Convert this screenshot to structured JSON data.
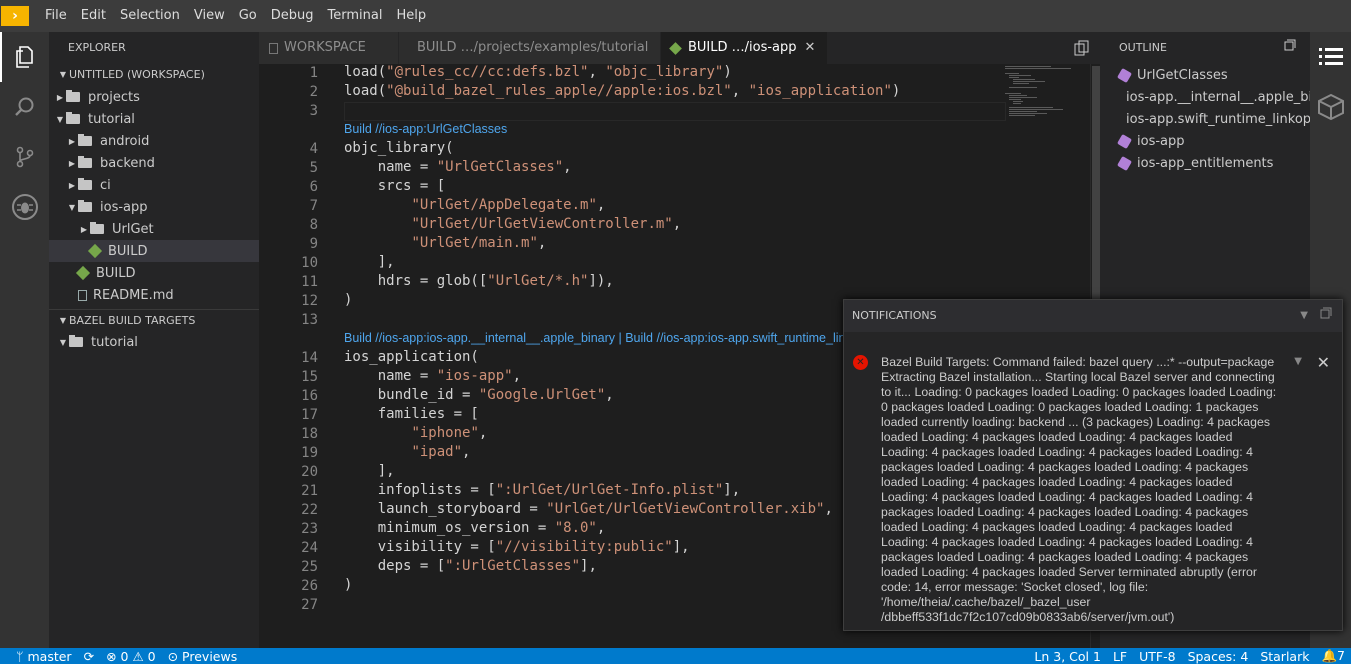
{
  "menubar": {
    "items": [
      "File",
      "Edit",
      "Selection",
      "View",
      "Go",
      "Debug",
      "Terminal",
      "Help"
    ]
  },
  "explorer": {
    "title": "EXPLORER",
    "workspace": "UNTITLED (WORKSPACE)",
    "tree": [
      {
        "label": "projects",
        "depth": 0,
        "kind": "folder",
        "open": false
      },
      {
        "label": "tutorial",
        "depth": 0,
        "kind": "folder",
        "open": true
      },
      {
        "label": "android",
        "depth": 1,
        "kind": "folder",
        "open": false
      },
      {
        "label": "backend",
        "depth": 1,
        "kind": "folder",
        "open": false
      },
      {
        "label": "ci",
        "depth": 1,
        "kind": "folder",
        "open": false
      },
      {
        "label": "ios-app",
        "depth": 1,
        "kind": "folder",
        "open": true
      },
      {
        "label": "UrlGet",
        "depth": 2,
        "kind": "folder",
        "open": false
      },
      {
        "label": "BUILD",
        "depth": 2,
        "kind": "bazel",
        "selected": true
      },
      {
        "label": "BUILD",
        "depth": 1,
        "kind": "bazel"
      },
      {
        "label": "README.md",
        "depth": 1,
        "kind": "doc"
      }
    ],
    "bazel_section": "BAZEL BUILD TARGETS",
    "bazel_tree": [
      {
        "label": "tutorial"
      }
    ]
  },
  "tabs": [
    {
      "label": "WORKSPACE",
      "active": false
    },
    {
      "label": "BUILD …/projects/examples/tutorial",
      "active": false
    },
    {
      "label": "BUILD …/ios-app",
      "active": true
    }
  ],
  "editor": {
    "lines": [
      {
        "n": "1",
        "text": "load(\"@rules_cc//cc:defs.bzl\", \"objc_library\")"
      },
      {
        "n": "2",
        "text": "load(\"@build_bazel_rules_apple//apple:ios.bzl\", \"ios_application\")"
      },
      {
        "n": "3",
        "text": ""
      },
      {
        "n": "4",
        "text": "objc_library("
      },
      {
        "n": "5",
        "text": "    name = \"UrlGetClasses\","
      },
      {
        "n": "6",
        "text": "    srcs = ["
      },
      {
        "n": "7",
        "text": "        \"UrlGet/AppDelegate.m\","
      },
      {
        "n": "8",
        "text": "        \"UrlGet/UrlGetViewController.m\","
      },
      {
        "n": "9",
        "text": "        \"UrlGet/main.m\","
      },
      {
        "n": "10",
        "text": "    ],"
      },
      {
        "n": "11",
        "text": "    hdrs = glob([\"UrlGet/*.h\"]),"
      },
      {
        "n": "12",
        "text": ")"
      },
      {
        "n": "13",
        "text": ""
      },
      {
        "n": "14",
        "text": "ios_application("
      },
      {
        "n": "15",
        "text": "    name = \"ios-app\","
      },
      {
        "n": "16",
        "text": "    bundle_id = \"Google.UrlGet\","
      },
      {
        "n": "17",
        "text": "    families = ["
      },
      {
        "n": "18",
        "text": "        \"iphone\","
      },
      {
        "n": "19",
        "text": "        \"ipad\","
      },
      {
        "n": "20",
        "text": "    ],"
      },
      {
        "n": "21",
        "text": "    infoplists = [\":UrlGet/UrlGet-Info.plist\"],"
      },
      {
        "n": "22",
        "text": "    launch_storyboard = \"UrlGet/UrlGetViewController.xib\","
      },
      {
        "n": "23",
        "text": "    minimum_os_version = \"8.0\","
      },
      {
        "n": "24",
        "text": "    visibility = [\"//visibility:public\"],"
      },
      {
        "n": "25",
        "text": "    deps = [\":UrlGetClasses\"],"
      },
      {
        "n": "26",
        "text": ")"
      },
      {
        "n": "27",
        "text": ""
      }
    ],
    "lens1": "Build //ios-app:UrlGetClasses",
    "lens2": "Build //ios-app:ios-app.__internal__.apple_binary | Build //ios-app:ios-app.swift_runtime_linkopts"
  },
  "outline": {
    "title": "OUTLINE",
    "items": [
      "UrlGetClasses",
      "ios-app.__internal__.apple_binary",
      "ios-app.swift_runtime_linkopts",
      "ios-app",
      "ios-app_entitlements"
    ]
  },
  "notifications": {
    "title": "NOTIFICATIONS",
    "message": "Bazel Build Targets: Command failed: bazel query ...:* --output=package Extracting Bazel installation... Starting local Bazel server and connecting to it... Loading: 0 packages loaded Loading: 0 packages loaded Loading: 0 packages loaded Loading: 0 packages loaded Loading: 1 packages loaded currently loading: backend ... (3 packages) Loading: 4 packages loaded Loading: 4 packages loaded Loading: 4 packages loaded Loading: 4 packages loaded Loading: 4 packages loaded Loading: 4 packages loaded Loading: 4 packages loaded Loading: 4 packages loaded Loading: 4 packages loaded Loading: 4 packages loaded Loading: 4 packages loaded Loading: 4 packages loaded Loading: 4 packages loaded Loading: 4 packages loaded Loading: 4 packages loaded Loading: 4 packages loaded Loading: 4 packages loaded Loading: 4 packages loaded Loading: 4 packages loaded Loading: 4 packages loaded Loading: 4 packages loaded Loading: 4 packages loaded Loading: 4 packages loaded Server terminated abruptly (error code: 14, error message: 'Socket closed', log file: '/home/theia/.cache/bazel/_bazel_user /dbbeff533f1dc7f2c107cd09b0833ab6/server/jvm.out')"
  },
  "status": {
    "branch": "master",
    "errors": "0",
    "warnings": "0",
    "previews": "Previews",
    "position": "Ln 3, Col 1",
    "eol": "LF",
    "encoding": "UTF-8",
    "spaces": "Spaces: 4",
    "language": "Starlark",
    "bell": "7"
  },
  "colors": {
    "accent": "#007acc",
    "string": "#ce9178",
    "lens": "#4fa6ed",
    "error": "#e51400"
  }
}
